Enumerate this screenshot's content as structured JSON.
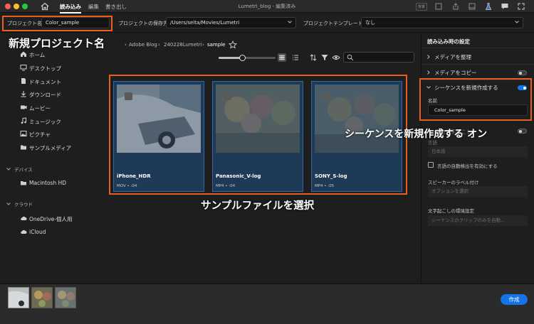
{
  "window": {
    "title": "Lumetri_blog - 編集済み",
    "tabs": [
      "読み込み",
      "編集",
      "書き出し"
    ],
    "active_tab": "読み込み",
    "badge": "背景"
  },
  "project_bar": {
    "name_label": "プロジェクト名",
    "name_value": "Color_sample",
    "location_label": "プロジェクトの保存先",
    "location_value": "/Users/seita/Movies/Lumetri",
    "template_label": "プロジェクトテンプレート",
    "template_value": "なし"
  },
  "annotations": {
    "project_name": "新規プロジェクト名",
    "select_files": "サンプルファイルを選択",
    "sequence_on": "シーケンスを新規作成する オン"
  },
  "sidebar": {
    "items": [
      {
        "label": "ホーム",
        "icon": "home-icon"
      },
      {
        "label": "デスクトップ",
        "icon": "desktop-icon"
      },
      {
        "label": "ドキュメント",
        "icon": "document-icon"
      },
      {
        "label": "ダウンロード",
        "icon": "download-icon"
      },
      {
        "label": "ムービー",
        "icon": "movie-icon"
      },
      {
        "label": "ミュージック",
        "icon": "music-icon"
      },
      {
        "label": "ピクチャ",
        "icon": "picture-icon"
      },
      {
        "label": "サンプルメディア",
        "icon": "folder-icon"
      }
    ],
    "devices_header": "デバイス",
    "devices": [
      {
        "label": "Macintosh HD",
        "icon": "drive-icon"
      }
    ],
    "cloud_header": "クラウド",
    "cloud": [
      {
        "label": "OneDrive-個人用",
        "icon": "cloud-icon"
      },
      {
        "label": "iCloud",
        "icon": "cloud-icon"
      }
    ]
  },
  "breadcrumb": [
    "Adobe Blog",
    "240228Lumetri",
    "sample"
  ],
  "thumbnail_size": 0.42,
  "clips": [
    {
      "name": "iPhone_HDR",
      "meta": "MOV • :04",
      "selected": true
    },
    {
      "name": "Panasonic_V-log",
      "meta": "MP4 • :04",
      "selected": true
    },
    {
      "name": "SONY_S-log",
      "meta": "MP4 • :05",
      "selected": true
    }
  ],
  "settings": {
    "title": "読み込み時の設定",
    "organize_media": "メディアを整理",
    "copy_media": "メディアをコピー",
    "copy_media_on": false,
    "new_sequence": "シーケンスを新規作成する",
    "new_sequence_on": true,
    "seq_name_label": "名前",
    "seq_name_value": "Color_sample",
    "auto_transcribe": "自動文字起こし",
    "language_label": "言語",
    "language_value": "日本語",
    "detect_language": "言語の自動検出を有効にする",
    "speaker_label": "スピーカーのラベル付け",
    "speaker_value": "オプションを選択",
    "transcribe_label": "文字起こしの環境設定",
    "transcribe_value": "シーケンスのクリップのみを自動..."
  },
  "footer": {
    "create_button": "作成"
  },
  "colors": {
    "accent": "#1473e6",
    "highlight_box": "#e8601c",
    "card_fill": "#1e3a56"
  }
}
